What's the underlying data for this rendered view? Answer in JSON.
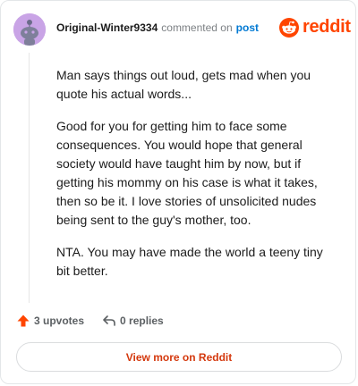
{
  "comment": {
    "author": "Original-Winter9334",
    "action_text": "commented on",
    "post_link": "post",
    "paragraphs": [
      "Man says things out loud, gets mad when you quote his actual words...",
      "Good for you for getting him to face some consequences. You would hope that general society would have taught him by now, but if getting his mommy on his case is what it takes, then so be it. I love stories of unsolicited nudes being sent to the guy's mother, too.",
      "NTA. You may have made the world a teeny tiny bit better."
    ]
  },
  "brand": {
    "logo_text": "reddit",
    "color": "#ff4500",
    "icon": "reddit-alien-icon"
  },
  "footer": {
    "upvotes_label": "3 upvotes",
    "replies_label": "0 replies",
    "upvote_icon": "upvote-arrow-icon",
    "reply_icon": "reply-icon",
    "upvote_color": "#ff4500"
  },
  "cta": {
    "view_more_label": "View more on Reddit"
  }
}
